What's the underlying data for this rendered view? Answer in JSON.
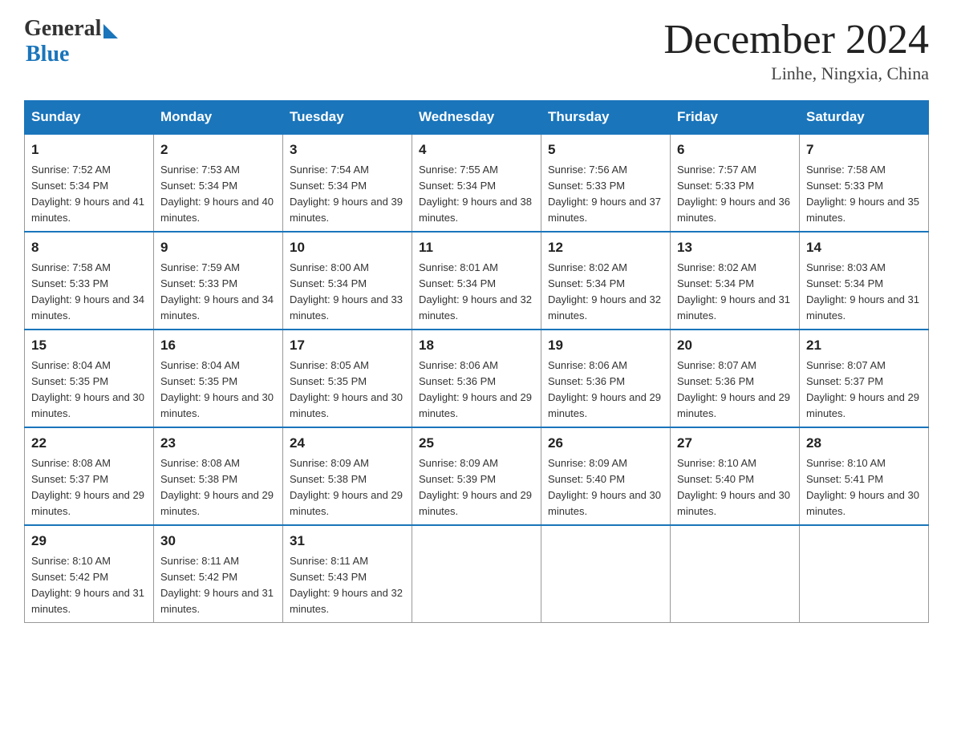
{
  "header": {
    "logo_general": "General",
    "logo_blue": "Blue",
    "month_title": "December 2024",
    "location": "Linhe, Ningxia, China"
  },
  "weekdays": [
    "Sunday",
    "Monday",
    "Tuesday",
    "Wednesday",
    "Thursday",
    "Friday",
    "Saturday"
  ],
  "weeks": [
    [
      {
        "day": "1",
        "sunrise": "7:52 AM",
        "sunset": "5:34 PM",
        "daylight": "9 hours and 41 minutes."
      },
      {
        "day": "2",
        "sunrise": "7:53 AM",
        "sunset": "5:34 PM",
        "daylight": "9 hours and 40 minutes."
      },
      {
        "day": "3",
        "sunrise": "7:54 AM",
        "sunset": "5:34 PM",
        "daylight": "9 hours and 39 minutes."
      },
      {
        "day": "4",
        "sunrise": "7:55 AM",
        "sunset": "5:34 PM",
        "daylight": "9 hours and 38 minutes."
      },
      {
        "day": "5",
        "sunrise": "7:56 AM",
        "sunset": "5:33 PM",
        "daylight": "9 hours and 37 minutes."
      },
      {
        "day": "6",
        "sunrise": "7:57 AM",
        "sunset": "5:33 PM",
        "daylight": "9 hours and 36 minutes."
      },
      {
        "day": "7",
        "sunrise": "7:58 AM",
        "sunset": "5:33 PM",
        "daylight": "9 hours and 35 minutes."
      }
    ],
    [
      {
        "day": "8",
        "sunrise": "7:58 AM",
        "sunset": "5:33 PM",
        "daylight": "9 hours and 34 minutes."
      },
      {
        "day": "9",
        "sunrise": "7:59 AM",
        "sunset": "5:33 PM",
        "daylight": "9 hours and 34 minutes."
      },
      {
        "day": "10",
        "sunrise": "8:00 AM",
        "sunset": "5:34 PM",
        "daylight": "9 hours and 33 minutes."
      },
      {
        "day": "11",
        "sunrise": "8:01 AM",
        "sunset": "5:34 PM",
        "daylight": "9 hours and 32 minutes."
      },
      {
        "day": "12",
        "sunrise": "8:02 AM",
        "sunset": "5:34 PM",
        "daylight": "9 hours and 32 minutes."
      },
      {
        "day": "13",
        "sunrise": "8:02 AM",
        "sunset": "5:34 PM",
        "daylight": "9 hours and 31 minutes."
      },
      {
        "day": "14",
        "sunrise": "8:03 AM",
        "sunset": "5:34 PM",
        "daylight": "9 hours and 31 minutes."
      }
    ],
    [
      {
        "day": "15",
        "sunrise": "8:04 AM",
        "sunset": "5:35 PM",
        "daylight": "9 hours and 30 minutes."
      },
      {
        "day": "16",
        "sunrise": "8:04 AM",
        "sunset": "5:35 PM",
        "daylight": "9 hours and 30 minutes."
      },
      {
        "day": "17",
        "sunrise": "8:05 AM",
        "sunset": "5:35 PM",
        "daylight": "9 hours and 30 minutes."
      },
      {
        "day": "18",
        "sunrise": "8:06 AM",
        "sunset": "5:36 PM",
        "daylight": "9 hours and 29 minutes."
      },
      {
        "day": "19",
        "sunrise": "8:06 AM",
        "sunset": "5:36 PM",
        "daylight": "9 hours and 29 minutes."
      },
      {
        "day": "20",
        "sunrise": "8:07 AM",
        "sunset": "5:36 PM",
        "daylight": "9 hours and 29 minutes."
      },
      {
        "day": "21",
        "sunrise": "8:07 AM",
        "sunset": "5:37 PM",
        "daylight": "9 hours and 29 minutes."
      }
    ],
    [
      {
        "day": "22",
        "sunrise": "8:08 AM",
        "sunset": "5:37 PM",
        "daylight": "9 hours and 29 minutes."
      },
      {
        "day": "23",
        "sunrise": "8:08 AM",
        "sunset": "5:38 PM",
        "daylight": "9 hours and 29 minutes."
      },
      {
        "day": "24",
        "sunrise": "8:09 AM",
        "sunset": "5:38 PM",
        "daylight": "9 hours and 29 minutes."
      },
      {
        "day": "25",
        "sunrise": "8:09 AM",
        "sunset": "5:39 PM",
        "daylight": "9 hours and 29 minutes."
      },
      {
        "day": "26",
        "sunrise": "8:09 AM",
        "sunset": "5:40 PM",
        "daylight": "9 hours and 30 minutes."
      },
      {
        "day": "27",
        "sunrise": "8:10 AM",
        "sunset": "5:40 PM",
        "daylight": "9 hours and 30 minutes."
      },
      {
        "day": "28",
        "sunrise": "8:10 AM",
        "sunset": "5:41 PM",
        "daylight": "9 hours and 30 minutes."
      }
    ],
    [
      {
        "day": "29",
        "sunrise": "8:10 AM",
        "sunset": "5:42 PM",
        "daylight": "9 hours and 31 minutes."
      },
      {
        "day": "30",
        "sunrise": "8:11 AM",
        "sunset": "5:42 PM",
        "daylight": "9 hours and 31 minutes."
      },
      {
        "day": "31",
        "sunrise": "8:11 AM",
        "sunset": "5:43 PM",
        "daylight": "9 hours and 32 minutes."
      },
      null,
      null,
      null,
      null
    ]
  ]
}
